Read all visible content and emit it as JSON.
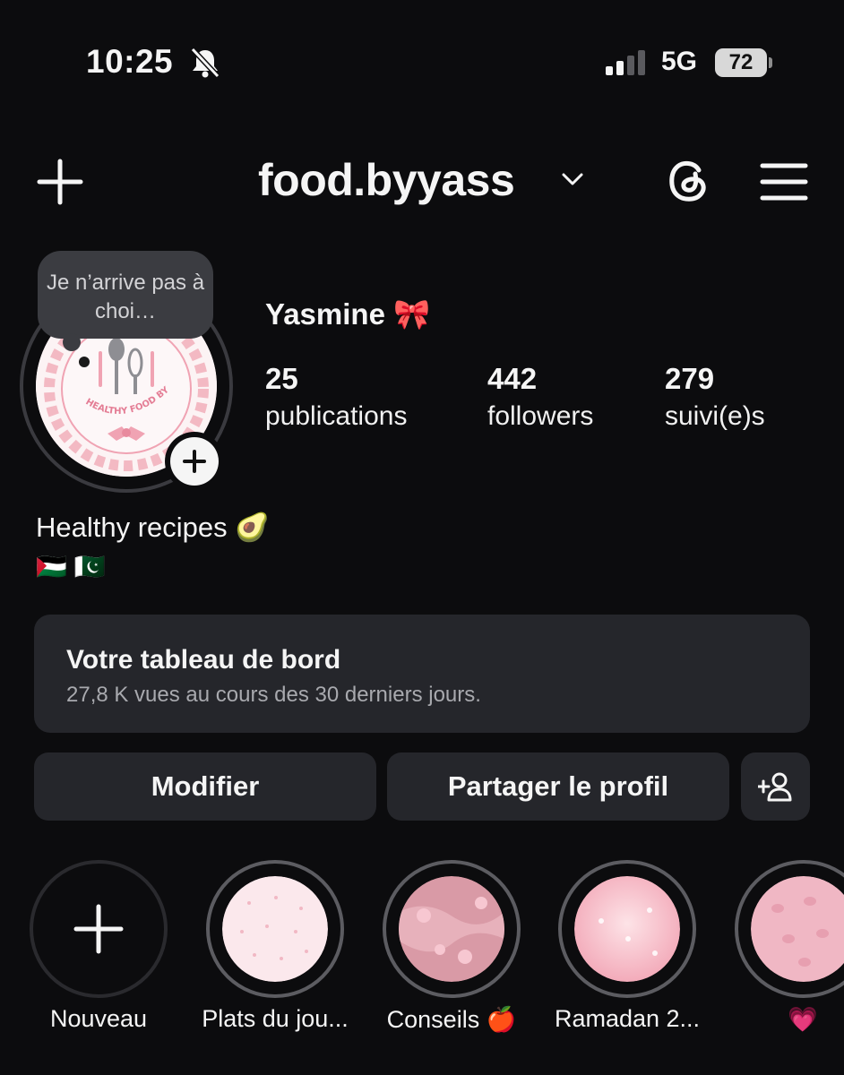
{
  "status_bar": {
    "time": "10:25",
    "network": "5G",
    "battery": "72"
  },
  "header": {
    "username": "food.byyass"
  },
  "profile": {
    "note": "Je n’arrive pas à choi…",
    "display_name": "Yasmine 🎀",
    "stats": [
      {
        "value": "25",
        "label": "publications"
      },
      {
        "value": "442",
        "label": "followers"
      },
      {
        "value": "279",
        "label": "suivi(e)s"
      }
    ],
    "bio": "Healthy recipes 🥑",
    "flags": "🇵🇸 🇵🇰",
    "avatar_logo_text": "HEALTHY FOOD BY YASS"
  },
  "dashboard": {
    "title": "Votre tableau de bord",
    "subtitle": "27,8 K vues au cours des 30 derniers jours."
  },
  "actions": {
    "edit_label": "Modifier",
    "share_label": "Partager le profil"
  },
  "highlights": [
    {
      "label": "Nouveau"
    },
    {
      "label": "Plats du jou..."
    },
    {
      "label": "Conseils 🍎"
    },
    {
      "label": "Ramadan 2..."
    },
    {
      "label": "💗"
    }
  ],
  "colors": {
    "background": "#0c0c0e",
    "card": "#25262b",
    "accent_pink": "#f0a3b3"
  }
}
